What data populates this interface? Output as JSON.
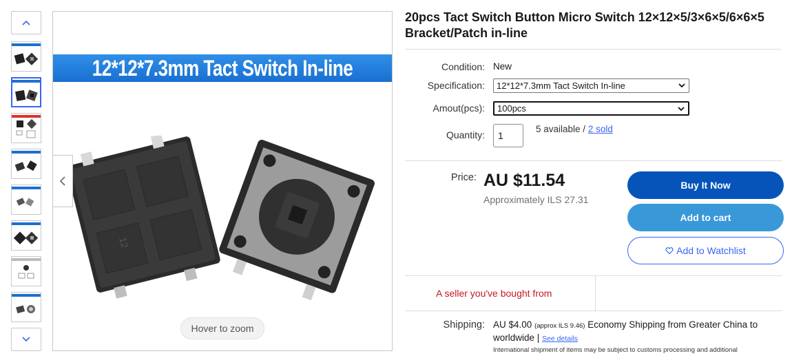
{
  "gallery": {
    "banner_text": "12*12*7.3mm Tact Switch In-line",
    "zoom_hint": "Hover to zoom",
    "thumbnail_count": 8,
    "selected_thumbnail": 2
  },
  "listing": {
    "title": "20pcs Tact Switch Button Micro Switch 12×12×5/3×6×5/6×6×5 Bracket/Patch in-line",
    "condition_label": "Condition:",
    "condition_value": "New",
    "specification_label": "Specification:",
    "specification_selected": "12*12*7.3mm Tact Switch In-line",
    "amount_label": "Amout(pcs):",
    "amount_selected": "100pcs",
    "quantity_label": "Quantity:",
    "quantity_value": "1",
    "available_text": "5 available / ",
    "sold_link": "2 sold"
  },
  "pricing": {
    "price_label": "Price:",
    "price": "AU $11.54",
    "approx": "Approximately ILS 27.31"
  },
  "actions": {
    "buy_now": "Buy It Now",
    "add_to_cart": "Add to cart",
    "watchlist": "Add to Watchlist"
  },
  "seller": {
    "note": "A seller you've bought from"
  },
  "shipping": {
    "label": "Shipping:",
    "cost": "AU $4.00",
    "cost_approx": "(approx ILS 9.46)",
    "description": "Economy Shipping from Greater China to worldwide",
    "separator": "|",
    "see_details": "See details",
    "intl_note": "International shipment of items may be subject to customs processing and additional"
  },
  "colors": {
    "accent_blue": "#3665f3",
    "buy_button": "#0654ba",
    "cart_button": "#3998d8",
    "seller_red": "#c4171f"
  }
}
